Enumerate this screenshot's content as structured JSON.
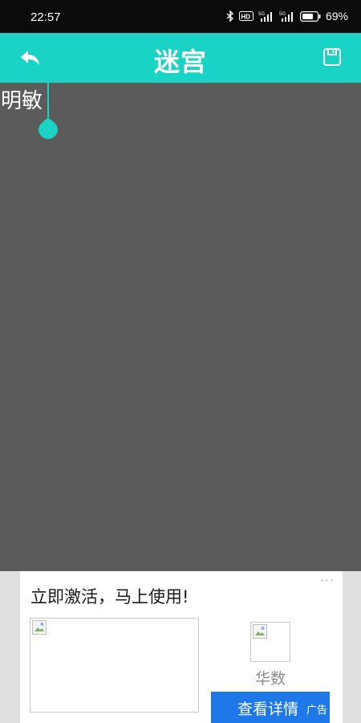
{
  "status_bar": {
    "time": "22:57",
    "battery_percent": "69%",
    "indicators": [
      "bluetooth-icon",
      "hd-icon",
      "5g-signal-icon",
      "5g-signal-icon",
      "battery-icon"
    ]
  },
  "app_bar": {
    "title": "迷宫",
    "back_icon": "back-arrow-icon",
    "save_icon": "save-icon",
    "color": "#19d3c5"
  },
  "editor": {
    "text": "明敏",
    "background": "#5b5b5b"
  },
  "ad": {
    "headline": "立即激活，马上使用!",
    "brand": "华数",
    "cta_label": "查看详情",
    "tag": "广告",
    "more_label": "···",
    "cta_color": "#1e78ea"
  }
}
